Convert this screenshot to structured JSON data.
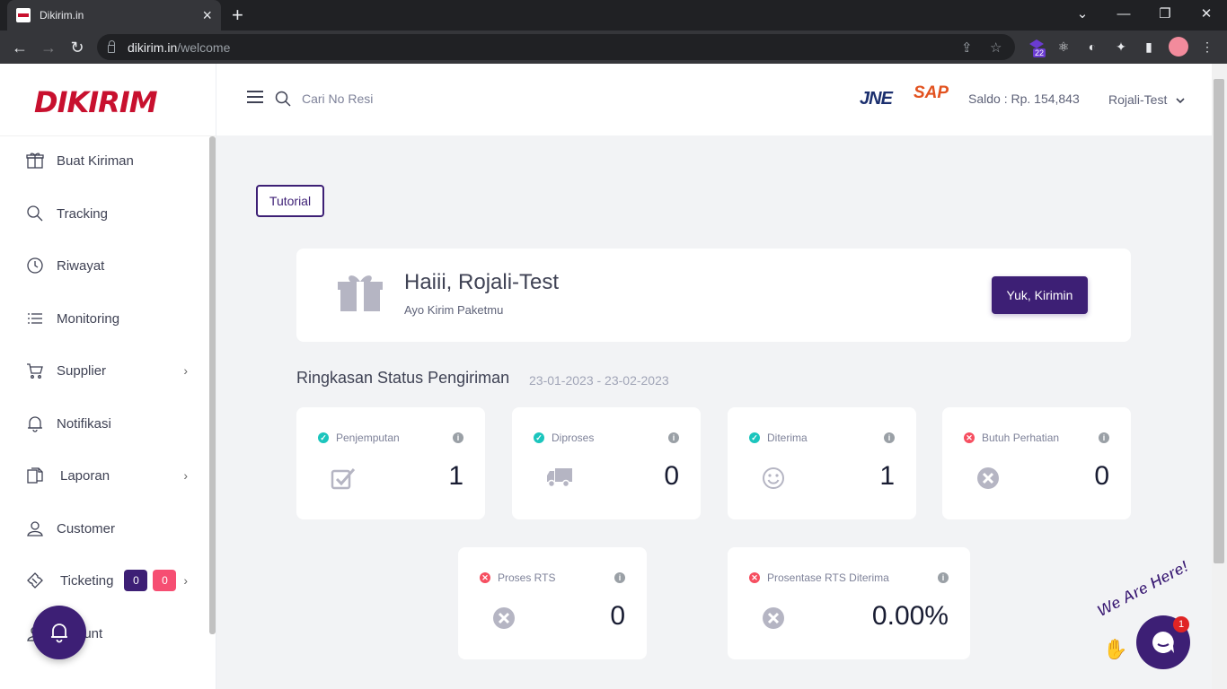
{
  "browser": {
    "tab_title": "Dikirim.in",
    "url_domain": "dikirim.in",
    "url_path": "/welcome",
    "ext_badge": "22"
  },
  "app": {
    "logo": "DIKIRIM",
    "search_placeholder": "Cari No Resi",
    "couriers": [
      "JNE",
      "SAP"
    ],
    "saldo": "Saldo : Rp. 154,843",
    "user": "Rojali-Test"
  },
  "sidebar": {
    "items": [
      {
        "label": "Buat Kiriman",
        "icon": "gift-icon"
      },
      {
        "label": "Tracking",
        "icon": "search-icon"
      },
      {
        "label": "Riwayat",
        "icon": "clock-icon"
      },
      {
        "label": "Monitoring",
        "icon": "list-icon"
      },
      {
        "label": "Supplier",
        "icon": "cart-icon"
      },
      {
        "label": "Notifikasi",
        "icon": "bell-icon"
      },
      {
        "label": "Laporan",
        "icon": "report-icon"
      },
      {
        "label": "Customer",
        "icon": "user-icon"
      },
      {
        "label": "Ticketing",
        "icon": "ticket-icon"
      },
      {
        "label": "ount",
        "icon": "account-icon"
      }
    ],
    "ticketing_badges": [
      "0",
      "0"
    ]
  },
  "main": {
    "tutorial_label": "Tutorial",
    "greeting": "Haiii, Rojali-Test",
    "greeting_sub": "Ayo Kirim Paketmu",
    "cta_label": "Yuk, Kirimin",
    "summary_title": "Ringkasan Status Pengiriman",
    "summary_range": "23-01-2023 - 23-02-2023",
    "cards": [
      {
        "label": "Penjemputan",
        "value": "1",
        "status": "ok"
      },
      {
        "label": "Diproses",
        "value": "0",
        "status": "ok"
      },
      {
        "label": "Diterima",
        "value": "1",
        "status": "ok"
      },
      {
        "label": "Butuh Perhatian",
        "value": "0",
        "status": "warn"
      },
      {
        "label": "Proses RTS",
        "value": "0",
        "status": "warn"
      },
      {
        "label": "Prosentase RTS Diterima",
        "value": "0.00%",
        "status": "warn"
      }
    ]
  },
  "chat": {
    "banner": "We Are Here!",
    "badge": "1"
  },
  "colors": {
    "brand": "#3d1f75",
    "ok": "#1bc5bd",
    "warn": "#f64e60",
    "logo_red": "#c8102e"
  }
}
